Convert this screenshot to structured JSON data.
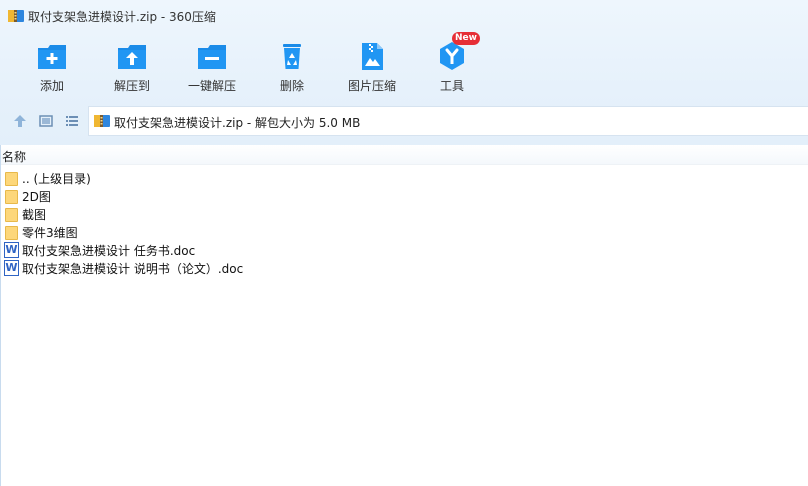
{
  "window": {
    "title": "取付支架急进模设计.zip - 360压缩"
  },
  "toolbar": {
    "buttons": [
      {
        "label": "添加",
        "icon": "add-icon"
      },
      {
        "label": "解压到",
        "icon": "extract-to-icon"
      },
      {
        "label": "一键解压",
        "icon": "one-click-extract-icon"
      },
      {
        "label": "删除",
        "icon": "recycle-bin-icon"
      },
      {
        "label": "图片压缩",
        "icon": "image-compress-icon"
      },
      {
        "label": "工具",
        "icon": "tools-icon",
        "badge": "New"
      }
    ]
  },
  "address": {
    "text": "取付支架急进模设计.zip - 解包大小为 5.0 MB"
  },
  "list": {
    "column_name": "名称",
    "items": [
      {
        "name": ".. (上级目录)",
        "type": "folder"
      },
      {
        "name": "2D图",
        "type": "folder"
      },
      {
        "name": "截图",
        "type": "folder"
      },
      {
        "name": "零件3维图",
        "type": "folder"
      },
      {
        "name": "取付支架急进模设计 任务书.doc",
        "type": "doc",
        "icon_glyph": "W"
      },
      {
        "name": "取付支架急进模设计 说明书（论文）.doc",
        "type": "doc",
        "icon_glyph": "W"
      }
    ]
  },
  "colors": {
    "accent_blue": "#1a8be8",
    "badge_red": "#e62e36",
    "folder_yellow": "#fdd77a",
    "word_blue": "#2f64c4"
  }
}
